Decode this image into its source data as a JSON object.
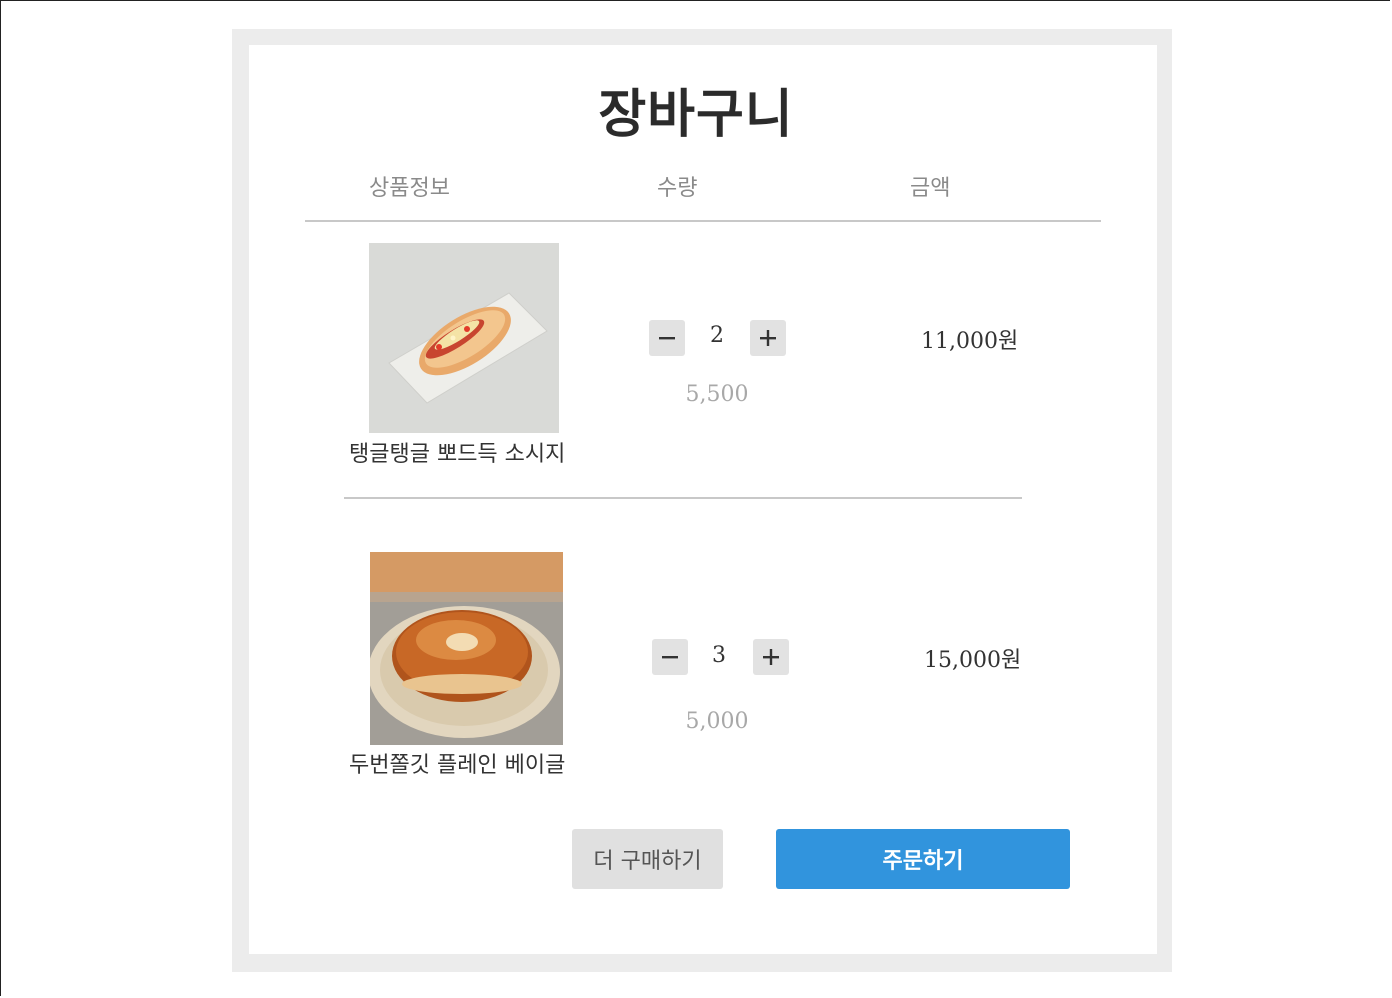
{
  "cart": {
    "title": "장바구니",
    "columns": {
      "product": "상품정보",
      "quantity": "수량",
      "amount": "금액"
    },
    "items": [
      {
        "name": "탱글탱글 뽀드득 소시지",
        "quantity": "2",
        "unit_price": "5,500",
        "amount": "11,000원",
        "image_icon": "sausage-bread-image"
      },
      {
        "name": "두번쫄깃 플레인 베이글",
        "quantity": "3",
        "unit_price": "5,000",
        "amount": "15,000원",
        "image_icon": "plain-bagel-image"
      }
    ],
    "actions": {
      "continue_label": "더 구매하기",
      "order_label": "주문하기"
    }
  },
  "colors": {
    "accent": "#3194dd",
    "stepper_bg": "#e2e2e2",
    "secondary_button_bg": "#e0e0e0"
  }
}
